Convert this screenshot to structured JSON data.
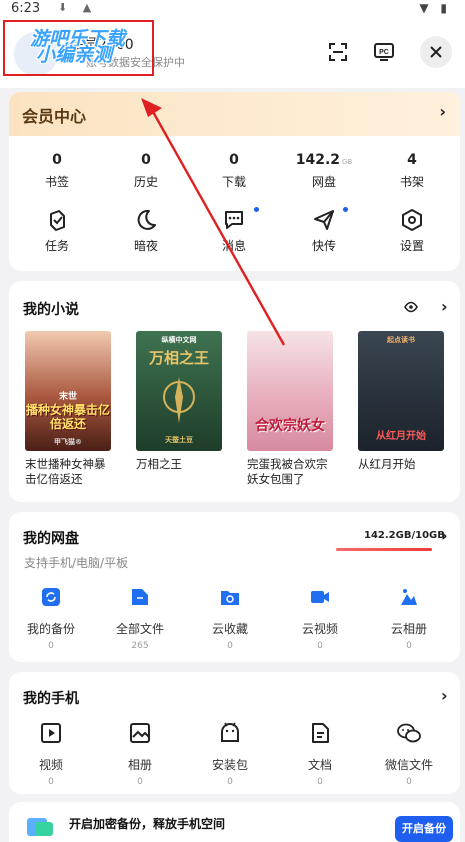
{
  "status_bar": {
    "time": "6:23"
  },
  "header": {
    "username": "会员2360",
    "subtitle": "账号数据安全保护中",
    "watermark_line1": "游吧乐下载",
    "watermark_line2": "小编亲测"
  },
  "vip": {
    "title": "会员中心"
  },
  "stats": [
    {
      "value": "0",
      "unit": "",
      "label": "书签"
    },
    {
      "value": "0",
      "unit": "",
      "label": "历史"
    },
    {
      "value": "0",
      "unit": "",
      "label": "下载"
    },
    {
      "value": "142.2",
      "unit": "GB",
      "label": "网盘"
    },
    {
      "value": "4",
      "unit": "",
      "label": "书架"
    }
  ],
  "tools": [
    {
      "label": "任务",
      "icon": "task-icon"
    },
    {
      "label": "暗夜",
      "icon": "moon-icon"
    },
    {
      "label": "消息",
      "icon": "message-icon"
    },
    {
      "label": "快传",
      "icon": "send-icon"
    },
    {
      "label": "设置",
      "icon": "settings-icon"
    }
  ],
  "novels": {
    "title": "我的小说",
    "books": [
      {
        "title": "末世播种女神暴击亿倍返还",
        "cover_text": "播种女神暴击亿倍返还",
        "cover_top": "末世",
        "cover_bottom": "甲飞猫®",
        "color": "#7a3a2a"
      },
      {
        "title": "万相之王",
        "cover_text": "万相之王",
        "cover_top": "纵横中文网",
        "cover_bottom": "天蚕土豆",
        "color": "#2f5a3a"
      },
      {
        "title": "完蛋我被合欢宗妖女包围了",
        "cover_text": "合欢宗妖女",
        "cover_top": "",
        "cover_bottom": "",
        "color": "#e8b7c2"
      },
      {
        "title": "从红月开始",
        "cover_text": "从红月开始",
        "cover_top": "起点读书",
        "cover_bottom": "",
        "color": "#28313c"
      }
    ]
  },
  "cloud": {
    "title": "我的网盘",
    "subtitle": "支持手机/电脑/平板",
    "usage": "142.2GB/10GB",
    "usage_fraction": 1.0,
    "items": [
      {
        "label": "我的备份",
        "count": "0",
        "icon": "backup-icon"
      },
      {
        "label": "全部文件",
        "count": "265",
        "icon": "files-icon"
      },
      {
        "label": "云收藏",
        "count": "0",
        "icon": "cloud-favorite-icon"
      },
      {
        "label": "云视频",
        "count": "0",
        "icon": "cloud-video-icon"
      },
      {
        "label": "云相册",
        "count": "0",
        "icon": "cloud-album-icon"
      }
    ]
  },
  "phone": {
    "title": "我的手机",
    "items": [
      {
        "label": "视频",
        "count": "0",
        "icon": "video-icon"
      },
      {
        "label": "相册",
        "count": "0",
        "icon": "album-icon"
      },
      {
        "label": "安装包",
        "count": "0",
        "icon": "apk-icon"
      },
      {
        "label": "文档",
        "count": "0",
        "icon": "document-icon"
      },
      {
        "label": "微信文件",
        "count": "0",
        "icon": "wechat-icon"
      }
    ]
  },
  "banner": {
    "text": "开启加密备份，释放手机空间",
    "button": "开启备份"
  },
  "colors": {
    "accent": "#1f5ff0",
    "vip_text": "#5b3a12",
    "annotation_red": "#e02020"
  }
}
